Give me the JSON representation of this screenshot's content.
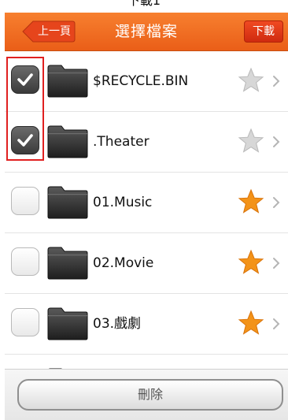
{
  "caption": "下載1",
  "header": {
    "back_label": "上一頁",
    "title": "選擇檔案",
    "next_label": "下載"
  },
  "files": [
    {
      "name": "$RECYCLE.BIN",
      "checked": true,
      "favorite": false
    },
    {
      "name": ".Theater",
      "checked": true,
      "favorite": false
    },
    {
      "name": "01.Music",
      "checked": false,
      "favorite": true
    },
    {
      "name": "02.Movie",
      "checked": false,
      "favorite": true
    },
    {
      "name": "03.戲劇",
      "checked": false,
      "favorite": true
    },
    {
      "name": "",
      "checked": false,
      "favorite": false
    }
  ],
  "footer": {
    "delete_label": "刪除"
  },
  "colors": {
    "header_orange": "#f36d25",
    "next_button_red": "#e03a18",
    "favorite_orange": "#f39319",
    "star_off_gray": "#d7d7d7",
    "highlight_red": "#e02020"
  }
}
